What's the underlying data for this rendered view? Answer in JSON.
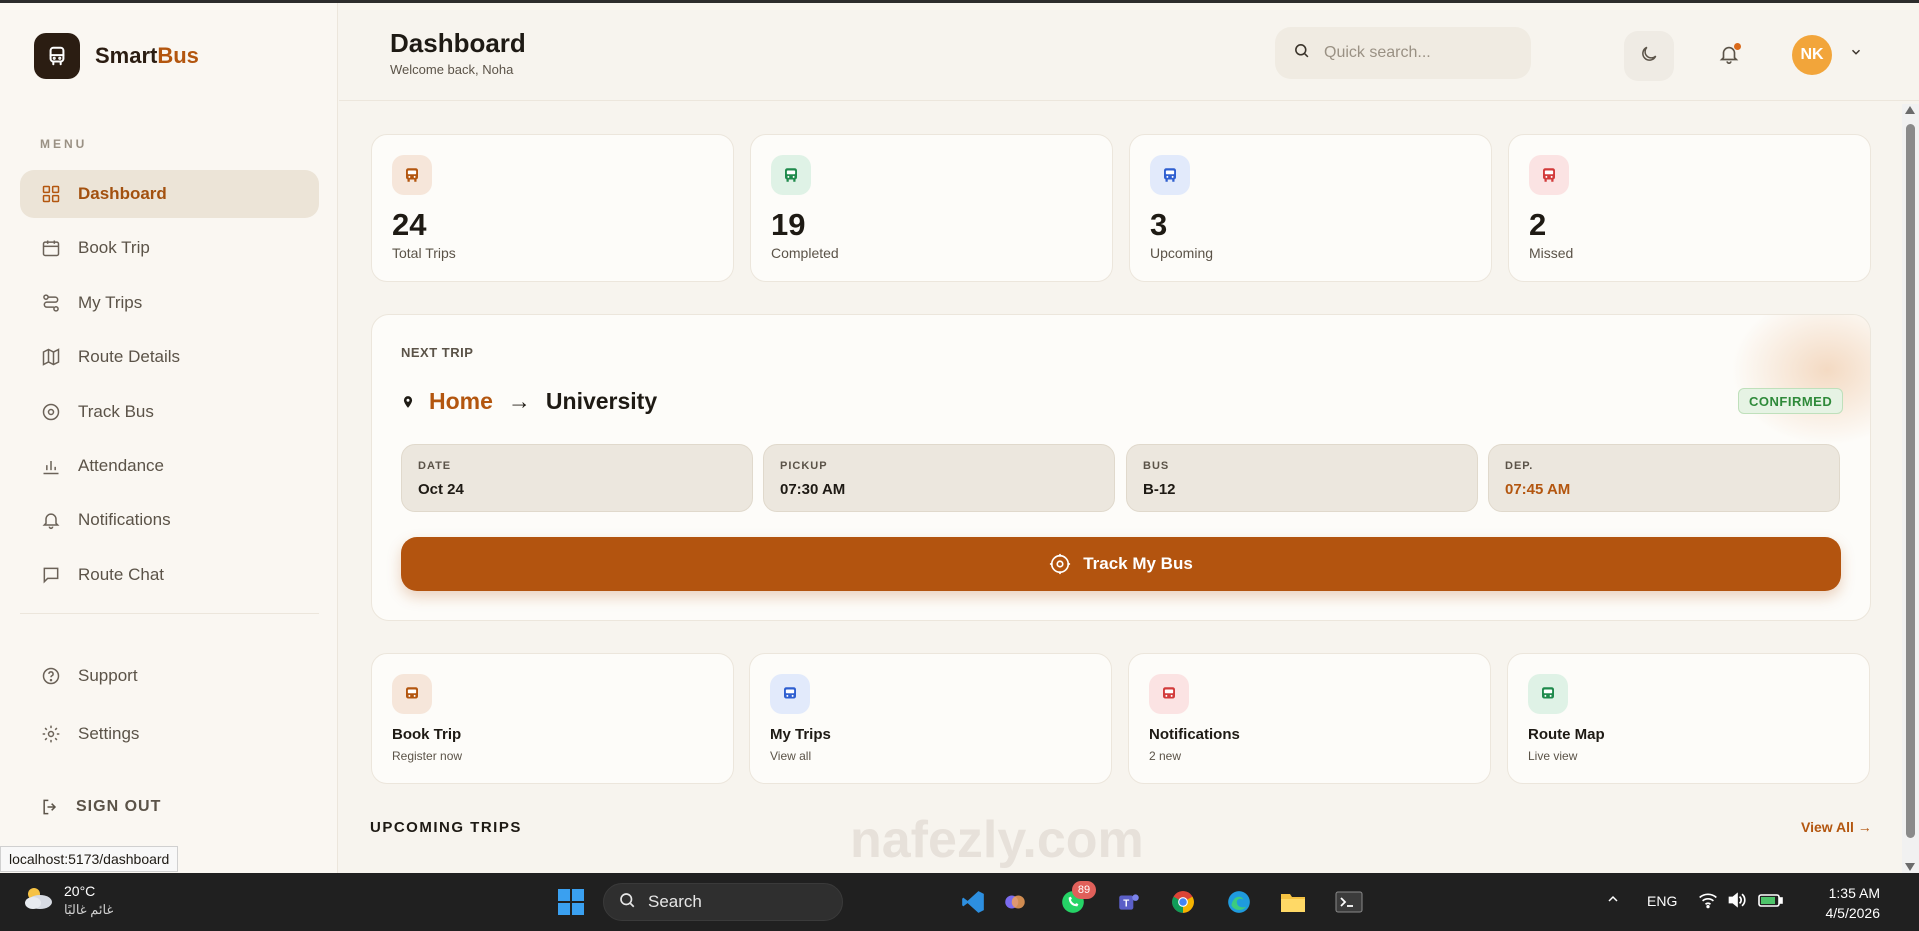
{
  "app": {
    "name_part1": "Smart",
    "name_part2": "Bus"
  },
  "sidebar": {
    "menu_label": "MENU",
    "items": [
      {
        "label": "Dashboard",
        "icon": "grid-icon",
        "active": true
      },
      {
        "label": "Book Trip",
        "icon": "calendar-icon"
      },
      {
        "label": "My Trips",
        "icon": "route-icon"
      },
      {
        "label": "Route Details",
        "icon": "map-icon"
      },
      {
        "label": "Track Bus",
        "icon": "target-icon"
      },
      {
        "label": "Attendance",
        "icon": "bar-chart-icon"
      },
      {
        "label": "Notifications",
        "icon": "bell-icon"
      },
      {
        "label": "Route Chat",
        "icon": "chat-icon"
      }
    ],
    "bottom_items": [
      {
        "label": "Support",
        "icon": "help-icon"
      },
      {
        "label": "Settings",
        "icon": "gear-icon"
      }
    ],
    "signout_label": "SIGN OUT"
  },
  "header": {
    "title": "Dashboard",
    "subtitle": "Welcome back, Noha",
    "search_placeholder": "Quick search...",
    "avatar_initials": "NK"
  },
  "stats": [
    {
      "value": "24",
      "label": "Total Trips",
      "color": "#b3560f"
    },
    {
      "value": "19",
      "label": "Completed",
      "color": "#1f8a4c"
    },
    {
      "value": "3",
      "label": "Upcoming",
      "color": "#2f5fd0"
    },
    {
      "value": "2",
      "label": "Missed",
      "color": "#d23b3b"
    }
  ],
  "next_trip": {
    "label": "NEXT TRIP",
    "from": "Home",
    "arrow": "→",
    "to": "University",
    "status": "CONFIRMED",
    "details": [
      {
        "key": "DATE",
        "value": "Oct 24"
      },
      {
        "key": "PICKUP",
        "value": "07:30 AM"
      },
      {
        "key": "BUS",
        "value": "B-12"
      },
      {
        "key": "DEP.",
        "value": "07:45 AM"
      }
    ],
    "button_label": "Track My Bus"
  },
  "quick_actions": [
    {
      "title": "Book Trip",
      "subtitle": "Register now",
      "color": "#b3560f"
    },
    {
      "title": "My Trips",
      "subtitle": "View all",
      "color": "#2f5fd0"
    },
    {
      "title": "Notifications",
      "subtitle": "2 new",
      "color": "#d23b3b"
    },
    {
      "title": "Route Map",
      "subtitle": "Live view",
      "color": "#1f8a4c"
    }
  ],
  "upcoming": {
    "title": "UPCOMING TRIPS",
    "view_all": "View All →"
  },
  "status_bar": {
    "url": "localhost:5173/dashboard"
  },
  "taskbar": {
    "weather_temp": "20°C",
    "weather_desc": "غائم غالبًا",
    "search_label": "Search",
    "whatsapp_badge": "89",
    "language": "ENG",
    "time": "1:35 AM",
    "date": "4/5/2026"
  },
  "watermark": "nafezly.com",
  "colors": {
    "accent": "#b3560f",
    "confirmed": "#2f8a3a"
  }
}
